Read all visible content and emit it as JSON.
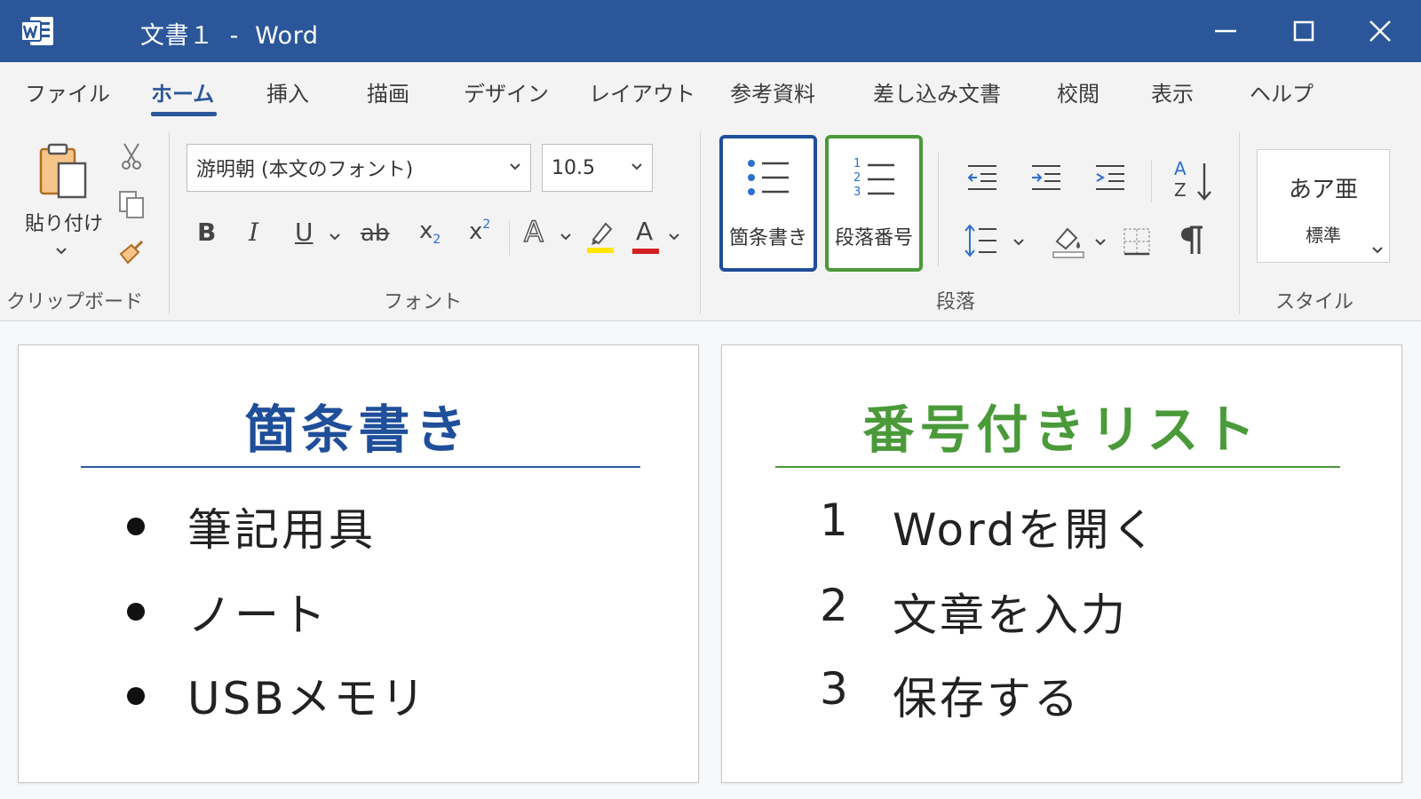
{
  "titlebar": {
    "title": "文書１  -  Word",
    "background": "#2b579a",
    "controls": [
      "minimize-icon",
      "maximize-icon",
      "close-icon"
    ]
  },
  "ribbon": {
    "tabs": [
      {
        "label": "ファイル",
        "active": false
      },
      {
        "label": "ホーム",
        "active": true
      },
      {
        "label": "挿入",
        "active": false
      },
      {
        "label": "描画",
        "active": false
      },
      {
        "label": "デザイン",
        "active": false
      },
      {
        "label": "レイアウト",
        "active": false
      },
      {
        "label": "参考資料",
        "active": false
      },
      {
        "label": "差し込み文書",
        "active": false
      },
      {
        "label": "校閲",
        "active": false
      },
      {
        "label": "表示",
        "active": false
      },
      {
        "label": "ヘルプ",
        "active": false
      }
    ],
    "clipboard": {
      "group_label": "クリップボード",
      "paste_label": "貼り付け",
      "icons": [
        "paste-icon",
        "cut-icon",
        "copy-icon",
        "format-painter-icon"
      ]
    },
    "font": {
      "group_label": "フォント",
      "font_name": "游明朝 (本文のフォント)",
      "font_size": "10.5",
      "bold": "B",
      "italic": "I",
      "underline": "U",
      "strikethrough": "ab",
      "subscript_base": "x",
      "subscript_mark": "2",
      "superscript_base": "x",
      "superscript_mark": "2",
      "text_effects": "A",
      "font_color": "A",
      "highlight_color": "#ffe600",
      "font_color_value": "#d42020"
    },
    "paragraph": {
      "group_label": "段落",
      "bullets_label": "箇条書き",
      "numbering_label": "段落番号",
      "numbering_digits": [
        "1",
        "2",
        "3"
      ],
      "sort_letters": [
        "A",
        "Z"
      ],
      "icons": [
        "bullets-icon",
        "numbering-icon",
        "decrease-indent-icon",
        "increase-indent-icon",
        "multilevel-list-icon",
        "sort-icon",
        "line-spacing-icon",
        "shading-icon",
        "borders-icon",
        "pilcrow-icon"
      ],
      "bullets_highlight": "#1f4e9a",
      "numbering_highlight": "#4a9a3a"
    },
    "styles": {
      "group_label": "スタイル",
      "preview_text": "あア亜",
      "style_name": "標準"
    }
  },
  "panels": {
    "bullets": {
      "title": "箇条書き",
      "color": "#1f4e9a",
      "items": [
        "筆記用具",
        "ノート",
        "USBメモリ"
      ]
    },
    "numbered": {
      "title": "番号付きリスト",
      "color": "#4a9a3a",
      "items": [
        {
          "number": "1",
          "text": "Wordを開く"
        },
        {
          "number": "2",
          "text": "文章を入力"
        },
        {
          "number": "3",
          "text": "保存する"
        }
      ]
    }
  }
}
